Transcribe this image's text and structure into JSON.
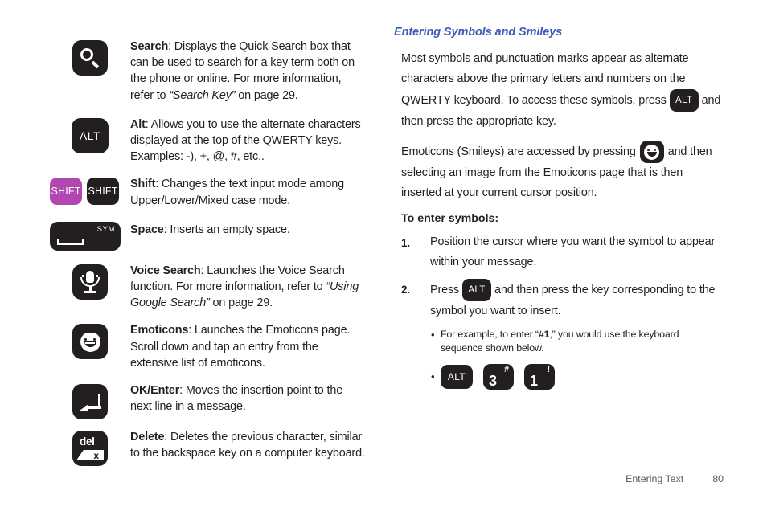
{
  "left_column": {
    "items": [
      {
        "key_name": "search-key",
        "icon": "magnifier-icon",
        "term": "Search",
        "desc_parts": [
          {
            "t": ": Displays the Quick Search box that can be used to search for a key term both on the phone or online. For more information, refer to ",
            "style": "normal"
          },
          {
            "t": "“Search Key”",
            "style": "italic"
          },
          {
            "t": "  on page 29.",
            "style": "normal"
          }
        ]
      },
      {
        "key_name": "alt-key",
        "icon": "alt-text-key",
        "label": "ALT",
        "term": "Alt",
        "desc_parts": [
          {
            "t": ": Allows you to use the alternate characters displayed at the top of the QWERTY keys. Examples: -), +, @, #, etc..",
            "style": "normal"
          }
        ]
      },
      {
        "key_name": "shift-key",
        "icon": "shift-text-key",
        "label_purple": "SHIFT",
        "label_black": "SHIFT",
        "purple_color": "#b247b2",
        "term": "Shift",
        "desc_parts": [
          {
            "t": ": Changes the text input mode among Upper/Lower/Mixed case mode.",
            "style": "normal"
          }
        ]
      },
      {
        "key_name": "space-key",
        "icon": "spacebar-icon",
        "sym_label": "SYM",
        "term": "Space",
        "desc_parts": [
          {
            "t": ": Inserts an empty space.",
            "style": "normal"
          }
        ]
      },
      {
        "key_name": "voice-search-key",
        "icon": "microphone-icon",
        "term": "Voice Search",
        "desc_parts": [
          {
            "t": ": Launches the Voice Search function. For more information, refer to ",
            "style": "normal"
          },
          {
            "t": "“Using Google Search”",
            "style": "italic"
          },
          {
            "t": "  on page 29.",
            "style": "normal"
          }
        ]
      },
      {
        "key_name": "emoticons-key",
        "icon": "smiley-face-icon",
        "term": "Emoticons",
        "desc_parts": [
          {
            "t": ": Launches the Emoticons page. Scroll down and tap an entry from the extensive list of emoticons.",
            "style": "normal"
          }
        ]
      },
      {
        "key_name": "ok-enter-key",
        "icon": "enter-arrow-icon",
        "term": "OK/Enter",
        "desc_parts": [
          {
            "t": ": Moves the insertion point to the next line in a message.",
            "style": "normal"
          }
        ]
      },
      {
        "key_name": "delete-key",
        "icon": "delete-icon",
        "label": "del",
        "tag_label": "x",
        "term": "Delete",
        "desc_parts": [
          {
            "t": ": Deletes the previous character, similar to the backspace key on a computer keyboard.",
            "style": "normal"
          }
        ]
      }
    ]
  },
  "right_column": {
    "heading": "Entering Symbols and Smileys",
    "heading_color": "#3e5bb8",
    "para1_a": "Most symbols and punctuation marks appear as alternate characters above the primary letters and numbers on the QWERTY keyboard. To access these symbols, press",
    "para1_key": "ALT",
    "para1_b": "and then press the appropriate key.",
    "para2_a": "Emoticons (Smileys) are accessed by pressing",
    "para2_b": "and then selecting an image from the Emoticons page that is then inserted at your current cursor position.",
    "subheading": "To enter symbols:",
    "steps": [
      {
        "num": "1.",
        "text": "Position the cursor where you want the symbol to appear within your message."
      },
      {
        "num": "2.",
        "text_a": "Press",
        "key": "ALT",
        "text_b": "and then press the key corresponding to the symbol you want to insert."
      }
    ],
    "bullets": [
      {
        "dot": "•",
        "text_a": "For example, to enter “",
        "bold": "#1",
        "text_b": ",” you would use the keyboard sequence shown below."
      }
    ],
    "sequence": {
      "dot": "•",
      "keys": [
        {
          "name": "alt-key",
          "main": "ALT",
          "alt": ""
        },
        {
          "name": "three-key",
          "main": "3",
          "alt": "#"
        },
        {
          "name": "one-key",
          "main": "1",
          "alt": "!"
        }
      ]
    }
  },
  "footer": {
    "section": "Entering Text",
    "page": "80"
  }
}
